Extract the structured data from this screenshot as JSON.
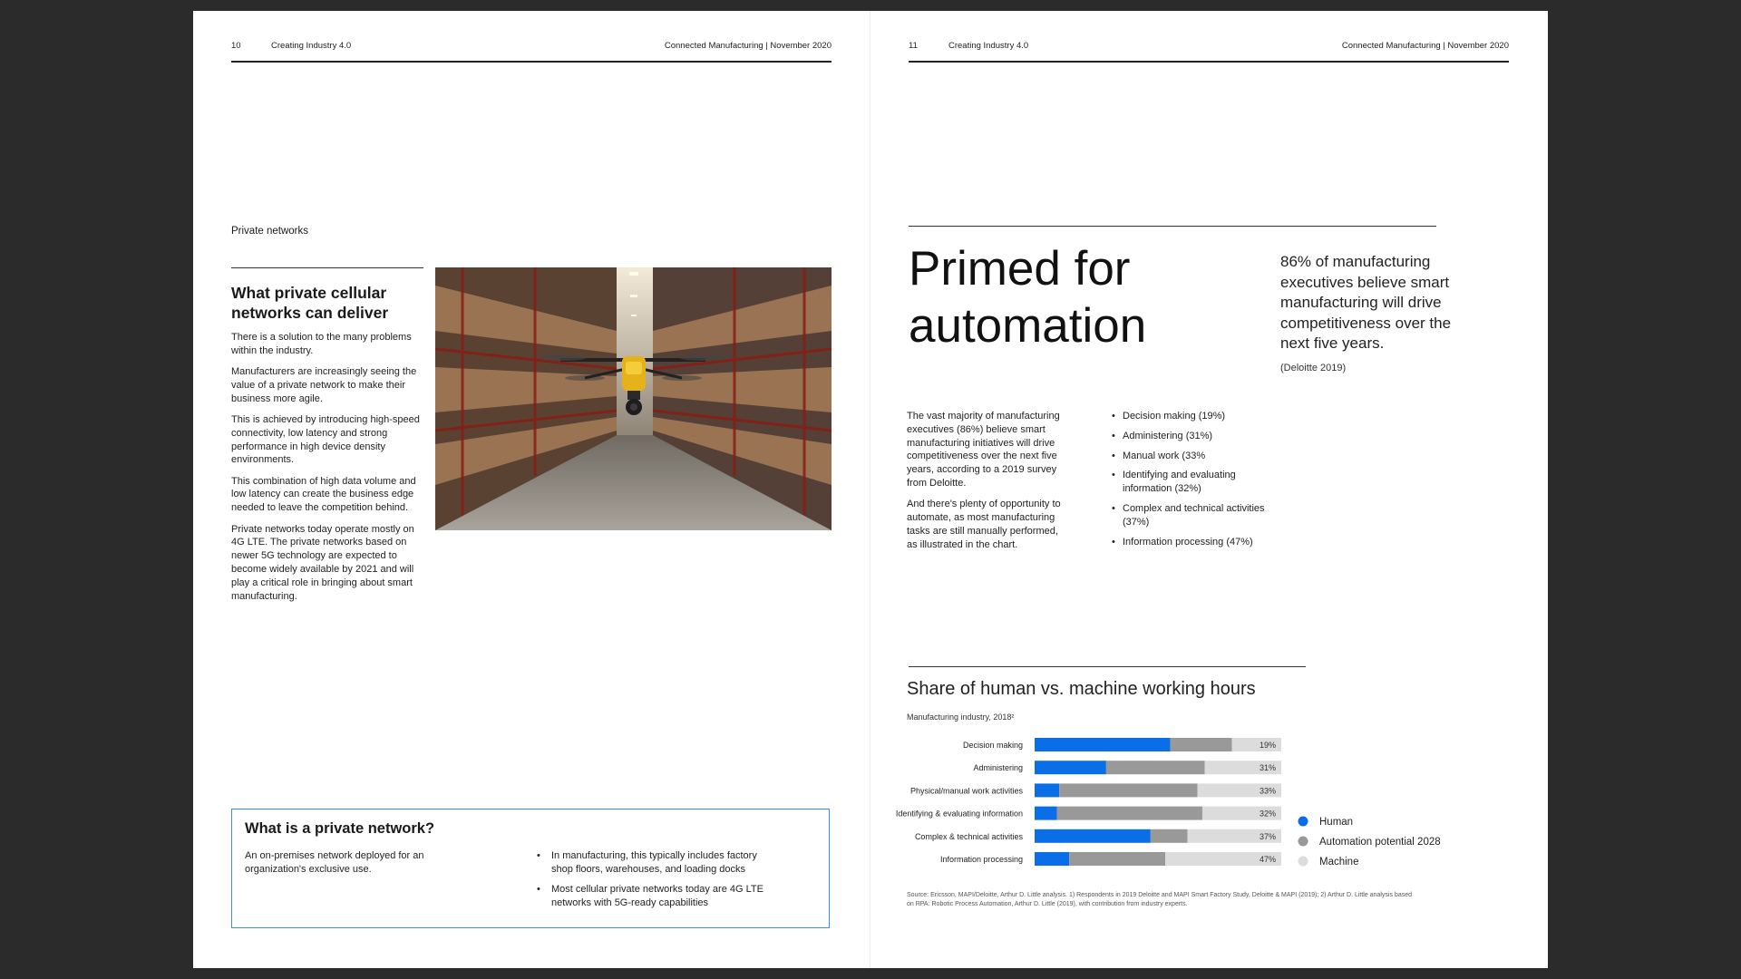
{
  "left_page": {
    "header": {
      "page_number": "10",
      "doc_title": "Creating Industry 4.0",
      "meta": "Connected Manufacturing  |  November 2020"
    },
    "section_label": "Private networks",
    "heading": "What private cellular networks can deliver",
    "paragraphs": [
      "There is a solution to the many problems within the industry.",
      "Manufacturers are increasingly seeing the value of a private network to make their business more agile.",
      "This is achieved by introducing high-speed connectivity, low latency and strong performance in high device density environments.",
      "This combination of high data volume and low latency can create the business edge needed to leave the competition behind.",
      "Private networks today operate mostly on 4G LTE. The private networks based on newer 5G technology are expected to become widely available by 2021 and will play a critical role in bringing about smart manufacturing."
    ],
    "private_network_box": {
      "title": "What is a private network?",
      "definition": "An on-premises network deployed for an organization's exclusive use.",
      "bullets": [
        "In manufacturing, this typically includes factory shop floors, warehouses, and loading docks",
        "Most cellular private networks today are 4G LTE networks with 5G-ready capabilities"
      ]
    }
  },
  "right_page": {
    "header": {
      "page_number": "11",
      "doc_title": "Creating Industry 4.0",
      "meta": "Connected Manufacturing  |  November 2020"
    },
    "title": "Primed for automation",
    "quote": "86% of manufacturing executives believe smart manufacturing will drive competitiveness over the next five years.",
    "quote_source": "(Deloitte 2019)",
    "body": [
      "The vast majority of manufacturing executives (86%) believe smart manufacturing initiatives will drive competitiveness over the next five years, according to a 2019 survey from Deloitte.",
      "And there's plenty of opportunity to automate, as most manufacturing tasks are still manually performed, as illustrated in the chart."
    ],
    "bullets": [
      "Decision making (19%)",
      "Administering (31%)",
      "Manual work (33%",
      "Identifying and evaluating information (32%)",
      "Complex and technical activities (37%)",
      "Information processing (47%)"
    ],
    "chart_source": "Source: Ericsson, MAPI/Deloitte, Arthur D. Little analysis. 1) Respondents in 2019 Deloitte and MAPI Smart Factory Study, Deloitte & MAPI (2019); 2) Arthur D. Little analysis based on RPA: Robotic Process Automation, Arthur D.  Little (2019), with contribution from industry experts."
  },
  "chart_data": {
    "type": "bar",
    "orientation": "horizontal",
    "stacked": true,
    "title": "Share of human vs. machine working hours",
    "subtitle": "Manufacturing industry, 2018²",
    "categories": [
      "Decision making",
      "Administering",
      "Physical/manual work activities",
      "Identifying & evaluating information",
      "Complex & technical activities",
      "Information processing"
    ],
    "series": [
      {
        "name": "Human",
        "color": "#0a6ee6",
        "values": [
          55,
          29,
          10,
          9,
          47,
          14
        ]
      },
      {
        "name": "Automation potential 2028",
        "color": "#999999",
        "values": [
          25,
          40,
          56,
          59,
          15,
          39
        ]
      },
      {
        "name": "Machine",
        "color": "#dcdcdc",
        "values": [
          20,
          31,
          34,
          32,
          38,
          47
        ]
      }
    ],
    "data_labels": [
      "19%",
      "31%",
      "33%",
      "32%",
      "37%",
      "47%"
    ],
    "xlim": [
      0,
      100
    ],
    "grid": false,
    "legend_position": "right"
  }
}
